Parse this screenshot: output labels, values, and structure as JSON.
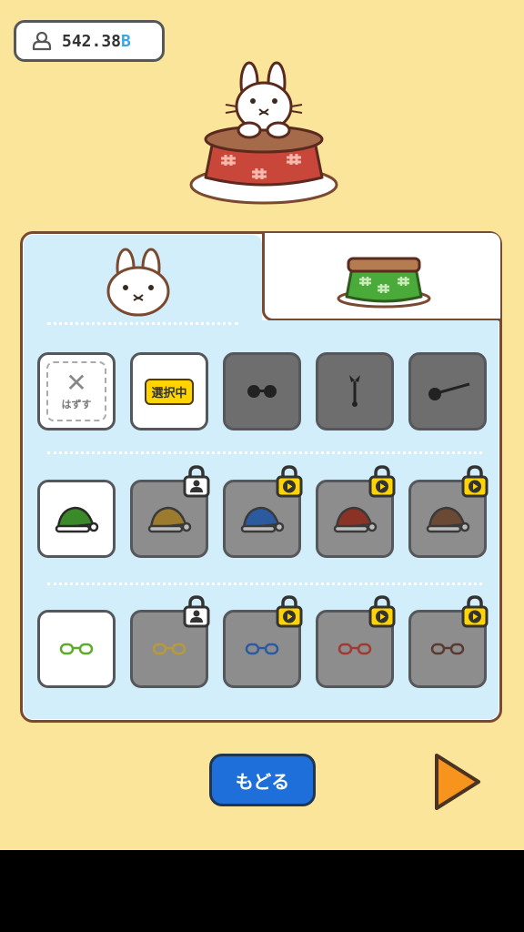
{
  "currency": {
    "amount": "542.38",
    "unit": "B",
    "icon": "coin-stack-icon"
  },
  "tabs": [
    {
      "name": "character",
      "icon": "bunny-face-icon",
      "active": true
    },
    {
      "name": "kotatsu",
      "icon": "kotatsu-icon",
      "active": false
    }
  ],
  "rows": [
    {
      "category": "face",
      "items": [
        {
          "state": "none",
          "label": "はずす"
        },
        {
          "state": "selected",
          "label": "選択中"
        },
        {
          "state": "available",
          "icon": "sunglasses-icon"
        },
        {
          "state": "available",
          "icon": "tie-icon"
        },
        {
          "state": "available",
          "icon": "eyepatch-icon"
        }
      ]
    },
    {
      "category": "hat",
      "items": [
        {
          "state": "owned",
          "icon": "santa-hat-icon",
          "color": "#3a8a2a"
        },
        {
          "state": "locked-user",
          "icon": "santa-hat-icon",
          "color": "#9c7a2e"
        },
        {
          "state": "locked-video",
          "icon": "santa-hat-icon",
          "color": "#2c5aa0"
        },
        {
          "state": "locked-video",
          "icon": "santa-hat-icon",
          "color": "#8a3225"
        },
        {
          "state": "locked-video",
          "icon": "santa-hat-icon",
          "color": "#6a4a35"
        }
      ]
    },
    {
      "category": "glasses",
      "items": [
        {
          "state": "owned",
          "icon": "glasses-icon",
          "color": "#5cab2a"
        },
        {
          "state": "locked-user",
          "icon": "glasses-icon",
          "color": "#b99a3a"
        },
        {
          "state": "locked-video",
          "icon": "glasses-icon",
          "color": "#2c5aa0"
        },
        {
          "state": "locked-video",
          "icon": "glasses-icon",
          "color": "#a03a30"
        },
        {
          "state": "locked-video",
          "icon": "glasses-icon",
          "color": "#5a3a30"
        }
      ]
    }
  ],
  "buttons": {
    "back_label": "もどる",
    "next_icon": "play-arrow-icon"
  },
  "colors": {
    "background": "#fbe59a",
    "panel_blue": "#d3eefb",
    "button_blue": "#1e6fd9",
    "lock_yellow": "#ffd400",
    "next_orange": "#f7941d"
  }
}
